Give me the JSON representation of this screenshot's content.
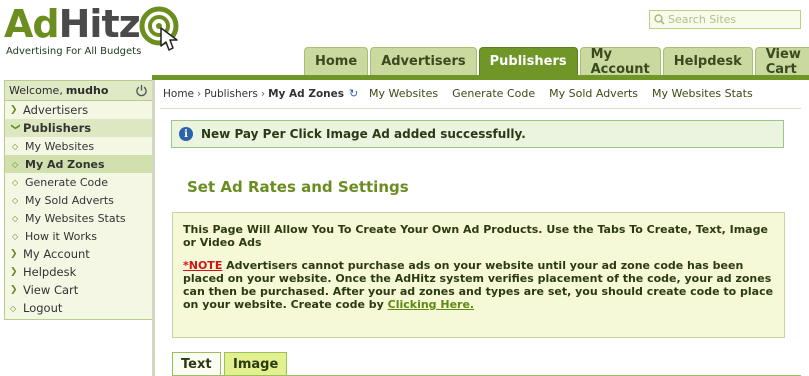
{
  "logo": {
    "ad": "Ad",
    "hitz": "Hitz",
    "tagline": "Advertising For All Budgets",
    "icon": "target-cursor-icon"
  },
  "search": {
    "placeholder": "Search Sites",
    "icon": "search-icon"
  },
  "nav": {
    "tabs": [
      {
        "label": "Home"
      },
      {
        "label": "Advertisers"
      },
      {
        "label": "Publishers",
        "active": true
      },
      {
        "label": "My Account"
      },
      {
        "label": "Helpdesk"
      },
      {
        "label": "View Cart",
        "icon": "cart-icon"
      }
    ]
  },
  "sidebar": {
    "welcome_label": "Welcome,",
    "username": "mudho",
    "items": [
      {
        "label": "Advertisers"
      },
      {
        "label": "Publishers"
      },
      {
        "label": "My Websites"
      },
      {
        "label": "My Ad Zones"
      },
      {
        "label": "Generate Code"
      },
      {
        "label": "My Sold Adverts"
      },
      {
        "label": "My Websites Stats"
      },
      {
        "label": "How it Works"
      },
      {
        "label": "My Account"
      },
      {
        "label": "Helpdesk"
      },
      {
        "label": "View Cart"
      },
      {
        "label": "Logout"
      }
    ]
  },
  "breadcrumb": {
    "home": "Home",
    "publishers": "Publishers",
    "current": "My Ad Zones"
  },
  "sublinks": [
    "My Websites",
    "Generate Code",
    "My Sold Adverts",
    "My Websites Stats"
  ],
  "success_message": "New Pay Per Click Image Ad added successfully.",
  "heading": "Set Ad Rates and Settings",
  "panel": {
    "intro": "This Page Will Allow You To Create Your Own Ad Products. Use the Tabs To Create, Text, Image or Video Ads",
    "note_label": "*NOTE",
    "note_text": " Advertisers cannot purchase ads on your website until your ad zone code has been placed on your website. Once the AdHitz system verifies placement of the code, your ad zones can then be purchased. After your ad zones and types are set, you should create code to place on your website. Create code by ",
    "link_text": "Clicking Here."
  },
  "bottom_tabs": [
    "Text",
    "Image"
  ],
  "colors": {
    "accent_green": "#6f9627",
    "tab_bg": "#c9d99f",
    "note_red": "#d21414",
    "success_bg": "#eaf4df",
    "info_blue": "#2c62a8"
  }
}
